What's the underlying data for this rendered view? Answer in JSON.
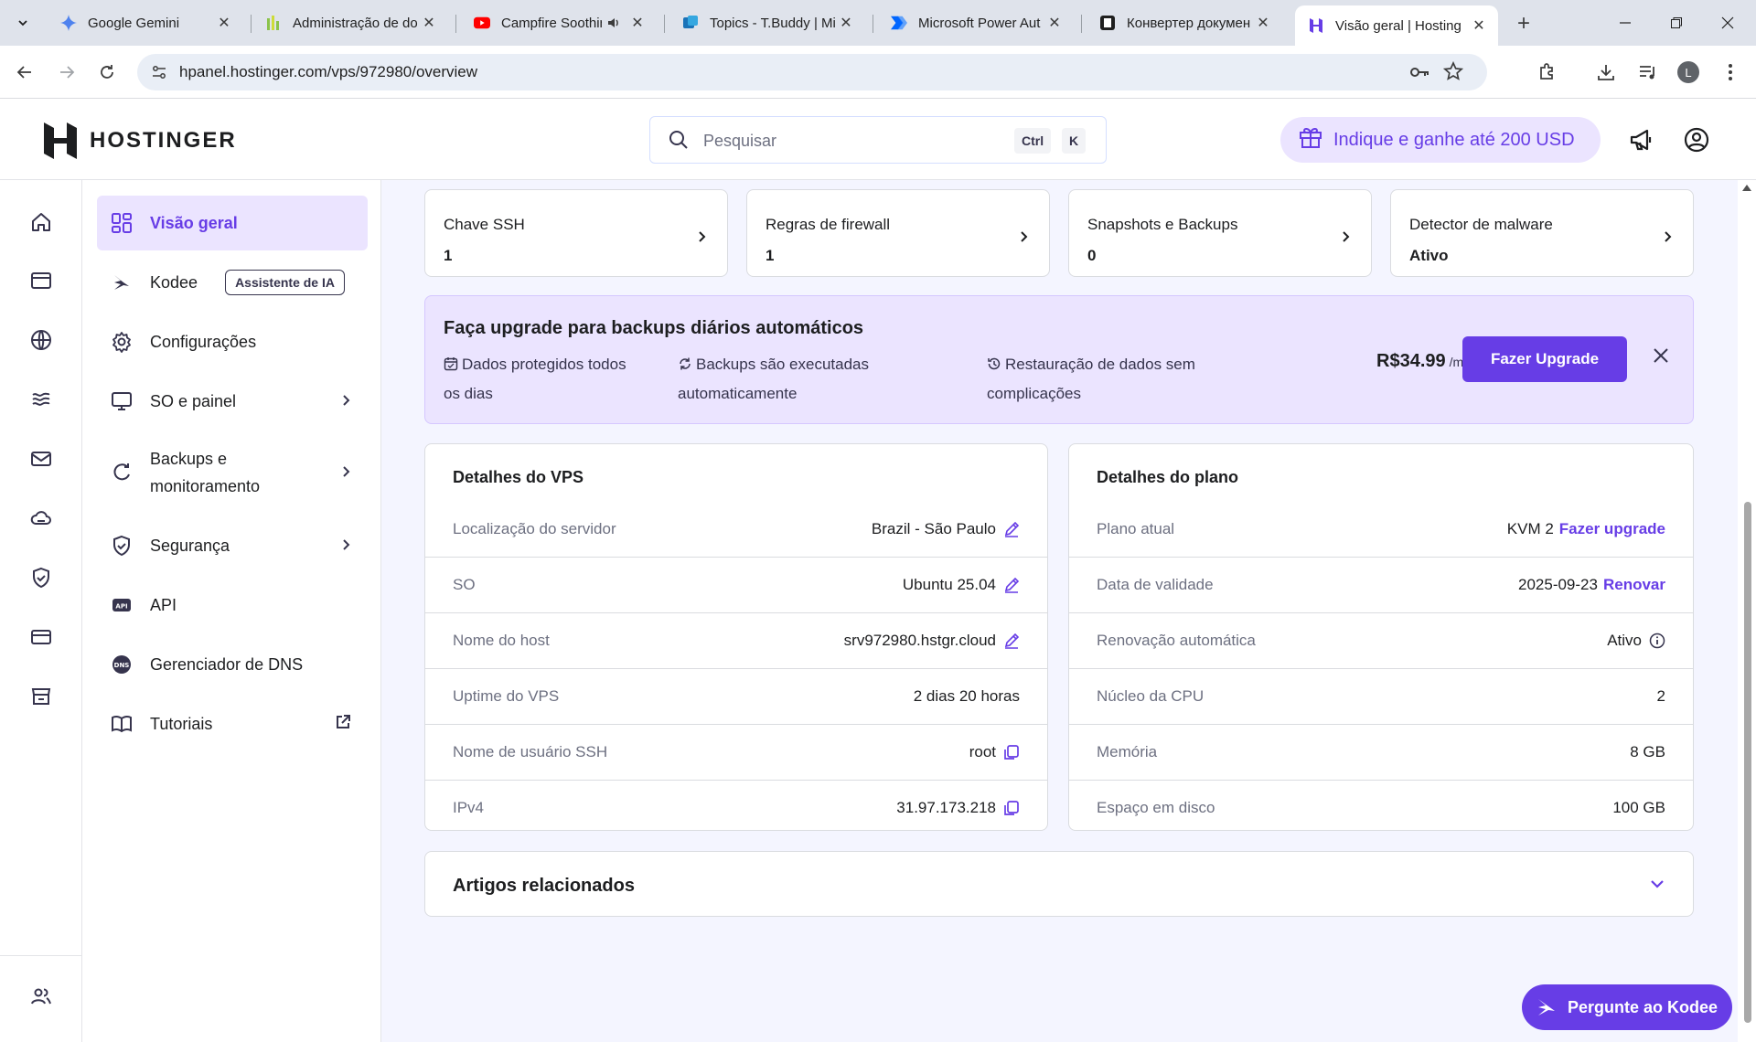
{
  "browser": {
    "tabs": [
      {
        "title": "Google Gemini",
        "icon": "gemini-icon"
      },
      {
        "title": "Administração de do",
        "icon": "bar-chart-icon"
      },
      {
        "title": "Campfire Soothin",
        "icon": "youtube-icon"
      },
      {
        "title": "Topics - T.Buddy | Mi",
        "icon": "tbuddy-icon"
      },
      {
        "title": "Microsoft Power Aut",
        "icon": "power-automate-icon"
      },
      {
        "title": "Конвертер докумен",
        "icon": "converter-icon"
      },
      {
        "title": "Visão geral | Hosting",
        "icon": "hostinger-icon",
        "active": true
      }
    ],
    "url": "hpanel.hostinger.com/vps/972980/overview",
    "profile_initial": "L"
  },
  "header": {
    "logo_text": "HOSTINGER",
    "search_placeholder": "Pesquisar",
    "shortcut_ctrl": "Ctrl",
    "shortcut_key": "K",
    "referral": "Indique e ganhe até 200 USD"
  },
  "menu": {
    "items": [
      {
        "label": "Visão geral",
        "icon": "grid-icon"
      },
      {
        "label": "Kodee",
        "icon": "kodee-icon",
        "badge": "Assistente de IA"
      },
      {
        "label": "Configurações",
        "icon": "gear-icon"
      },
      {
        "label": "SO e painel",
        "icon": "monitor-icon"
      },
      {
        "label": "Backups e monitoramento",
        "icon": "refresh-icon"
      },
      {
        "label": "Segurança",
        "icon": "shield-icon"
      },
      {
        "label": "API",
        "icon": "api-icon"
      },
      {
        "label": "Gerenciador de DNS",
        "icon": "dns-icon"
      },
      {
        "label": "Tutoriais",
        "icon": "book-icon"
      }
    ]
  },
  "stats": [
    {
      "label": "Chave SSH",
      "value": "1"
    },
    {
      "label": "Regras de firewall",
      "value": "1"
    },
    {
      "label": "Snapshots e Backups",
      "value": "0"
    },
    {
      "label": "Detector de malware",
      "value": "Ativo"
    }
  ],
  "upsell": {
    "title": "Faça upgrade para backups diários automáticos",
    "feature1_line1": "Dados protegidos todos",
    "feature1_line2": "os dias",
    "feature2_line1": "Backups são executadas",
    "feature2_line2": "automaticamente",
    "feature3_line1": "Restauração de dados sem",
    "feature3_line2": "complicações",
    "price": "R$34.99",
    "period": "/mês",
    "button": "Fazer Upgrade"
  },
  "vps": {
    "title": "Detalhes do VPS",
    "rows": [
      {
        "key": "Localização do servidor",
        "value": "Brazil - São Paulo"
      },
      {
        "key": "SO",
        "value": "Ubuntu 25.04"
      },
      {
        "key": "Nome do host",
        "value": "srv972980.hstgr.cloud"
      },
      {
        "key": "Uptime do VPS",
        "value": "2 dias 20 horas"
      },
      {
        "key": "Nome de usuário SSH",
        "value": "root"
      },
      {
        "key": "IPv4",
        "value": "31.97.173.218"
      }
    ]
  },
  "plan": {
    "title": "Detalhes do plano",
    "rows": [
      {
        "key": "Plano atual",
        "value": "KVM 2",
        "link": "Fazer upgrade"
      },
      {
        "key": "Data de validade",
        "value": "2025-09-23",
        "link": "Renovar"
      },
      {
        "key": "Renovação automática",
        "value": "Ativo"
      },
      {
        "key": "Núcleo da CPU",
        "value": "2"
      },
      {
        "key": "Memória",
        "value": "8 GB"
      },
      {
        "key": "Espaço em disco",
        "value": "100 GB"
      }
    ]
  },
  "articles": {
    "title": "Artigos relacionados"
  },
  "kodee_button": "Pergunte ao Kodee",
  "colors": {
    "accent": "#673de6",
    "accent_light": "#ebe4ff",
    "text": "#1d1e20",
    "muted": "#6d7081"
  }
}
